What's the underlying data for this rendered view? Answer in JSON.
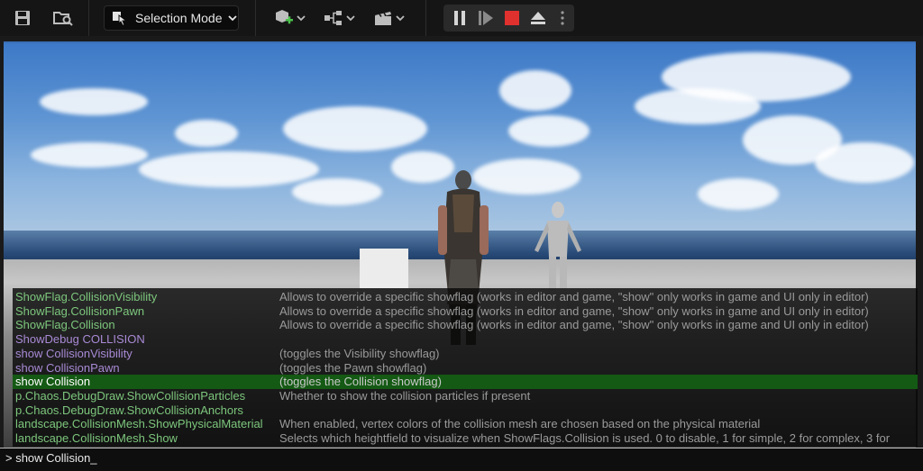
{
  "toolbar": {
    "mode_label": "Selection Mode",
    "icons": [
      "save-icon",
      "content-browser-icon",
      "chevron-down-icon",
      "add-actor-icon",
      "blueprint-icon",
      "cinematics-icon",
      "pause-icon",
      "step-icon",
      "stop-icon",
      "eject-icon",
      "more-options-icon"
    ]
  },
  "console": {
    "rows": [
      {
        "command": "ShowFlag.CollisionVisibility",
        "description": "Allows to override a specific showflag (works in editor and game, \"show\" only works in game and UI only in editor)",
        "color": "#7dc77d"
      },
      {
        "command": "ShowFlag.CollisionPawn",
        "description": "Allows to override a specific showflag (works in editor and game, \"show\" only works in game and UI only in editor)",
        "color": "#7dc77d"
      },
      {
        "command": "ShowFlag.Collision",
        "description": "Allows to override a specific showflag (works in editor and game, \"show\" only works in game and UI only in editor)",
        "color": "#7dc77d"
      },
      {
        "command": "ShowDebug COLLISION",
        "description": "",
        "color": "#a98ad6"
      },
      {
        "command": "show CollisionVisibility",
        "description": "(toggles the Visibility showflag)",
        "color": "#a98ad6"
      },
      {
        "command": "show CollisionPawn",
        "description": "(toggles the Pawn showflag)",
        "color": "#a98ad6"
      },
      {
        "command": "show Collision",
        "description": "(toggles the Collision showflag)",
        "color": "#ffffff",
        "selected": true
      },
      {
        "command": "p.Chaos.DebugDraw.ShowCollisionParticles",
        "description": "Whether to show the collision particles if present",
        "color": "#7dc77d"
      },
      {
        "command": "p.Chaos.DebugDraw.ShowCollisionAnchors",
        "description": "",
        "color": "#7dc77d"
      },
      {
        "command": "landscape.CollisionMesh.ShowPhysicalMaterial",
        "description": "When enabled, vertex colors of the collision mesh are chosen based on the physical material",
        "color": "#7dc77d"
      },
      {
        "command": "landscape.CollisionMesh.Show",
        "description": "Selects which heightfield to visualize when ShowFlags.Collision is used. 0 to disable, 1 for simple, 2 for complex, 3 for",
        "color": "#7dc77d"
      }
    ],
    "input": "> show Collision_"
  },
  "colors": {
    "selection_bg": "#145a14",
    "stop_red": "#e0312f",
    "viewport_border": "#3a6fb5"
  }
}
